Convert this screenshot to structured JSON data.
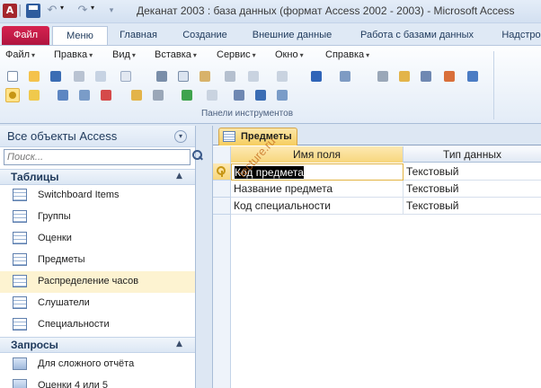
{
  "window": {
    "title": "Деканат 2003 : база данных (формат Access 2002 - 2003)  -  Microsoft Access",
    "app_icon": "A"
  },
  "ribbon_tabs": [
    "Файл",
    "Меню",
    "Главная",
    "Создание",
    "Внешние данные",
    "Работа с базами данных",
    "Надстро"
  ],
  "menus": [
    "Файл",
    "Правка",
    "Вид",
    "Вставка",
    "Сервис",
    "Окно",
    "Справка"
  ],
  "toolbar": {
    "group_label": "Панели инструментов"
  },
  "nav": {
    "title": "Все объекты Access",
    "search_placeholder": "Поиск...",
    "sections": [
      {
        "label": "Таблицы",
        "items": [
          "Switchboard Items",
          "Группы",
          "Оценки",
          "Предметы",
          "Распределение часов",
          "Слушатели",
          "Специальности"
        ]
      },
      {
        "label": "Запросы",
        "items": [
          "Для сложного отчёта",
          "Оценки 4 или 5"
        ]
      }
    ]
  },
  "document": {
    "tab_label": "Предметы",
    "columns": [
      "Имя поля",
      "Тип данных"
    ],
    "rows": [
      {
        "field": "Код предмета",
        "type": "Текстовый",
        "primary_key": true
      },
      {
        "field": "Название предмета",
        "type": "Текстовый"
      },
      {
        "field": "Код специальности",
        "type": "Текстовый"
      }
    ]
  },
  "watermark": "lecture.ru",
  "colors": {
    "file_tab": "#c8194a",
    "accent_blue": "#1e395b",
    "selection": "#f7d67c"
  }
}
